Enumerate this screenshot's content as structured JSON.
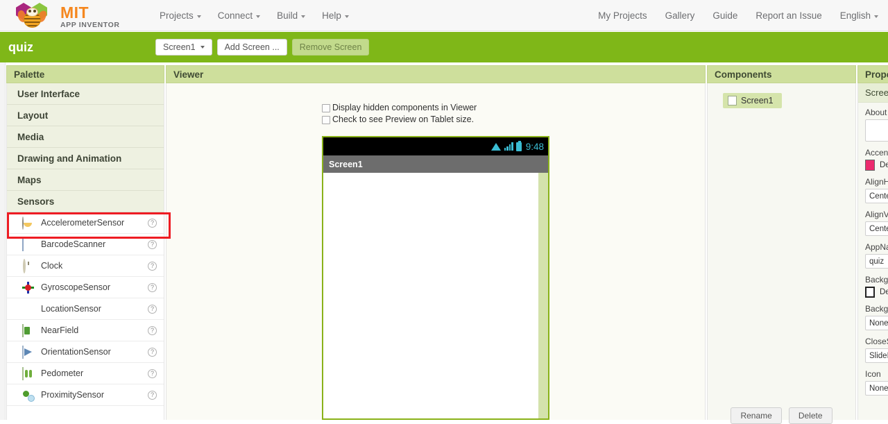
{
  "topbar": {
    "logo": {
      "mit": "MIT",
      "sub": "APP INVENTOR"
    },
    "menu": [
      {
        "label": "Projects",
        "caret": true
      },
      {
        "label": "Connect",
        "caret": true
      },
      {
        "label": "Build",
        "caret": true
      },
      {
        "label": "Help",
        "caret": true
      }
    ],
    "right_menu": [
      {
        "label": "My Projects",
        "caret": false
      },
      {
        "label": "Gallery",
        "caret": false
      },
      {
        "label": "Guide",
        "caret": false
      },
      {
        "label": "Report an Issue",
        "caret": false
      },
      {
        "label": "English",
        "caret": true
      }
    ]
  },
  "project_bar": {
    "project_name": "quiz",
    "screen_selector": "Screen1",
    "add_screen": "Add Screen ...",
    "remove_screen": "Remove Screen",
    "bar_color": "#7fb718"
  },
  "palette": {
    "header": "Palette",
    "categories": [
      {
        "label": "User Interface"
      },
      {
        "label": "Layout"
      },
      {
        "label": "Media"
      },
      {
        "label": "Drawing and Animation"
      },
      {
        "label": "Maps"
      },
      {
        "label": "Sensors"
      }
    ],
    "sensors": [
      {
        "label": "AccelerometerSensor",
        "icon": "accelerometer-icon",
        "help": "?",
        "highlighted": true
      },
      {
        "label": "BarcodeScanner",
        "icon": "barcode-icon",
        "help": "?",
        "highlighted": false
      },
      {
        "label": "Clock",
        "icon": "clock-icon",
        "help": "?",
        "highlighted": false
      },
      {
        "label": "GyroscopeSensor",
        "icon": "gyroscope-icon",
        "help": "?",
        "highlighted": false
      },
      {
        "label": "LocationSensor",
        "icon": "location-pin-icon",
        "help": "?",
        "highlighted": false
      },
      {
        "label": "NearField",
        "icon": "nfc-icon",
        "help": "?",
        "highlighted": false
      },
      {
        "label": "OrientationSensor",
        "icon": "orientation-icon",
        "help": "?",
        "highlighted": false
      },
      {
        "label": "Pedometer",
        "icon": "pedometer-icon",
        "help": "?",
        "highlighted": false
      },
      {
        "label": "ProximitySensor",
        "icon": "proximity-icon",
        "help": "?",
        "highlighted": false
      }
    ],
    "highlight_color": "#ee1c23"
  },
  "viewer": {
    "header": "Viewer",
    "checkboxes": [
      {
        "label": "Display hidden components in Viewer",
        "checked": false
      },
      {
        "label": "Check to see Preview on Tablet size.",
        "checked": false
      }
    ],
    "phone": {
      "status_time": "9:48",
      "title": "Screen1",
      "status_icons": [
        "wifi-icon",
        "signal-icon",
        "battery-icon"
      ],
      "border_color": "#8ab219"
    }
  },
  "components": {
    "header": "Components",
    "tree": [
      {
        "label": "Screen1",
        "selected": true
      }
    ],
    "buttons": [
      {
        "label": "Rename"
      },
      {
        "label": "Delete"
      }
    ]
  },
  "properties": {
    "header": "Prope",
    "selected": "Scree",
    "rows": [
      {
        "label": "About",
        "type": "textarea",
        "value": ""
      },
      {
        "label": "Accen",
        "type": "color",
        "value": "De",
        "swatch": "#ec2b6e"
      },
      {
        "label": "AlignH",
        "type": "select",
        "value": "Cente"
      },
      {
        "label": "AlignV",
        "type": "select",
        "value": "Cente"
      },
      {
        "label": "AppNa",
        "type": "text",
        "value": "quiz"
      },
      {
        "label": "Backg",
        "type": "color",
        "value": "De",
        "swatch": "#ffffff"
      },
      {
        "label": "Backg",
        "type": "select",
        "value": "None."
      },
      {
        "label": "CloseS",
        "type": "select",
        "value": "SlideH"
      },
      {
        "label": "Icon",
        "type": "select",
        "value": "None."
      }
    ]
  }
}
